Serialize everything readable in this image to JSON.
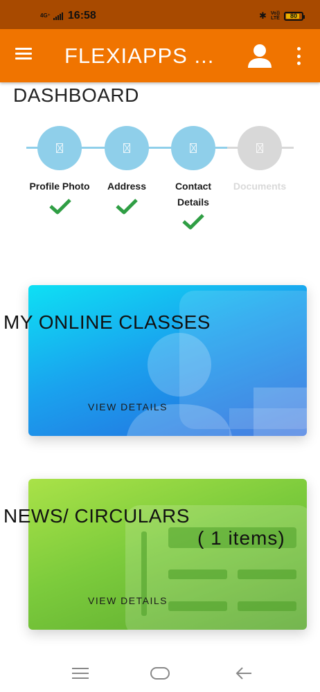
{
  "status_bar": {
    "network": "4G⁺",
    "time": "16:58",
    "bluetooth": "✱",
    "volte_line1": "Vo))",
    "volte_line2": "LTE",
    "battery": "80",
    "battery_level": 0.8
  },
  "app_bar": {
    "title": "FLEXIAPPS ...",
    "menu_icon": "hamburger-menu-icon",
    "user_icon": "account-icon",
    "more_icon": "more-vertical-icon",
    "color": "#f07400"
  },
  "dashboard": {
    "title": "DASHBOARD",
    "steps": [
      {
        "label": "Profile Photo",
        "completed": true
      },
      {
        "label": "Address",
        "completed": true
      },
      {
        "label": "Contact Details",
        "completed": true
      },
      {
        "label": "Documents",
        "completed": false
      }
    ],
    "colors": {
      "step_active": "#8fcfea",
      "step_inactive": "#d8d8d8",
      "check": "#2f9e44"
    }
  },
  "cards": {
    "online_classes": {
      "title": "MY ONLINE CLASSES",
      "action": "VIEW DETAILS"
    },
    "news": {
      "title": "NEWS/ CIRCULARS",
      "count": "( 1 items)",
      "action": "VIEW DETAILS"
    }
  },
  "nav_bar": {
    "recents_icon": "recents-icon",
    "home_icon": "home-icon",
    "back_icon": "back-arrow-icon"
  }
}
